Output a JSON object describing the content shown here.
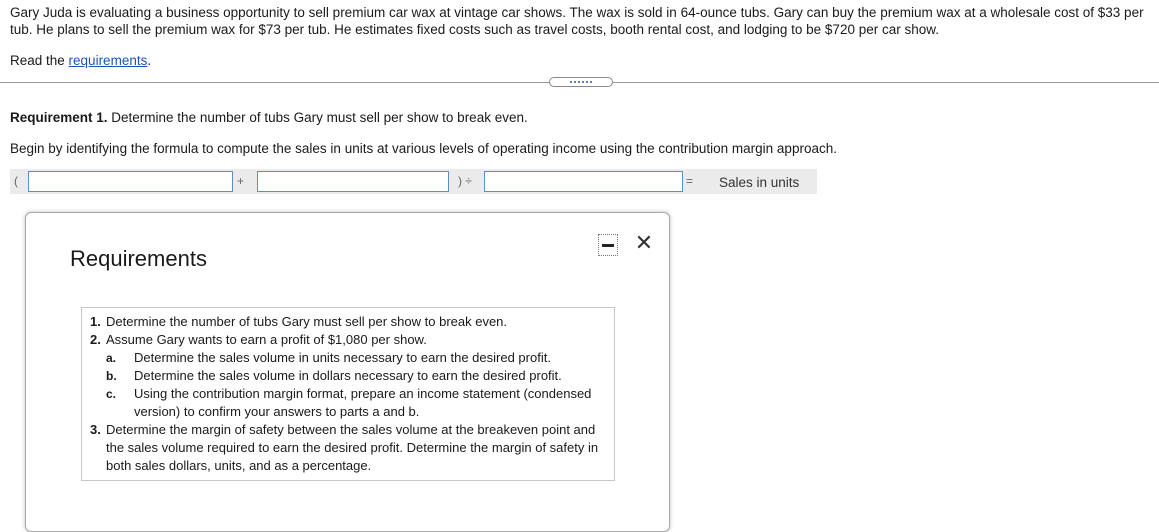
{
  "problem_text": "Gary Juda is evaluating a business opportunity to sell premium car wax at vintage car shows. The wax is sold in 64-ounce tubs. Gary can buy the premium wax at a wholesale cost of $33 per tub. He plans to sell the premium wax for $73 per tub. He estimates fixed costs such as travel costs, booth rental cost, and lodging to be $720 per car show.",
  "read_prefix": "Read the ",
  "read_link": "requirements",
  "read_suffix": ".",
  "requirement1_label": "Requirement 1.",
  "requirement1_text": " Determine the number of tubs Gary must sell per show to break even.",
  "begin_text": "Begin by identifying the formula to compute the sales in units at various levels of operating income using the contribution margin approach.",
  "formula": {
    "open_paren": "(",
    "plus": "+",
    "close_div": ") ÷",
    "equals": "=",
    "result_label": "Sales in units",
    "input1_value": "",
    "input2_value": "",
    "input3_value": ""
  },
  "modal": {
    "title": "Requirements",
    "minimize_icon": "minimize-icon",
    "close_icon": "close-icon",
    "close_glyph": "✕",
    "items": [
      {
        "num": "1.",
        "text": "Determine the number of tubs Gary must sell per show to break even."
      },
      {
        "num": "2.",
        "text": "Assume Gary wants to earn a profit of $1,080 per show."
      },
      {
        "num": "3.",
        "text": "Determine the margin of safety between the sales volume at the breakeven point and the sales volume required to earn the desired profit. Determine the margin of safety in both sales dollars, units, and as a percentage."
      }
    ],
    "subitems": [
      {
        "letter": "a.",
        "text": "Determine the sales volume in units necessary to earn the desired profit."
      },
      {
        "letter": "b.",
        "text": "Determine the sales volume in dollars necessary to earn the desired profit."
      },
      {
        "letter": "c.",
        "text": "Using the contribution margin format, prepare an income statement (condensed version) to confirm your answers to parts a and b."
      }
    ]
  }
}
